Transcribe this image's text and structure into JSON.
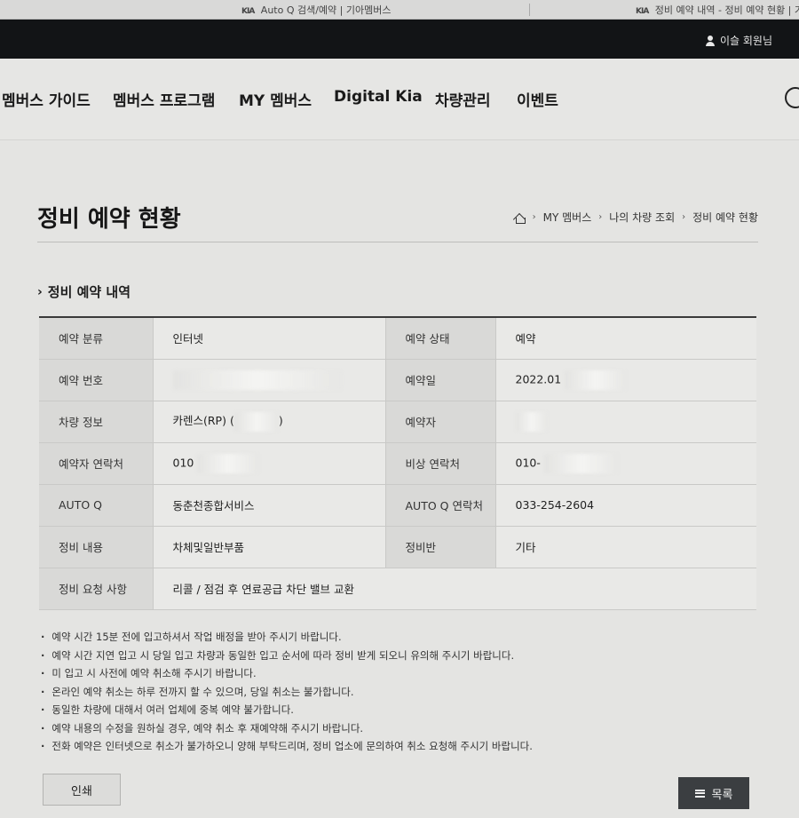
{
  "browser_tabs": [
    {
      "logo": "KIA",
      "title": "Auto Q 검색/예약 | 기아멤버스"
    },
    {
      "logo": "KIA",
      "title": "정비 예약 내역 - 정비 예약 현황 | 기"
    }
  ],
  "topbar": {
    "user_name": "이슬 회원님"
  },
  "nav": [
    {
      "label": "멤버스 가이드"
    },
    {
      "label": "멤버스 프로그램"
    },
    {
      "label": "MY 멤버스"
    },
    {
      "label": "Digital Kia"
    },
    {
      "label": "차량관리"
    },
    {
      "label": "이벤트"
    }
  ],
  "page": {
    "title": "정비 예약 현황"
  },
  "breadcrumb": [
    {
      "label": "MY 멤버스"
    },
    {
      "label": "나의 차량 조회"
    },
    {
      "label": "정비 예약 현황"
    }
  ],
  "section": {
    "title": "정비 예약 내역"
  },
  "details": {
    "type_label": "예약 분류",
    "type_value": "인터넷",
    "status_label": "예약 상태",
    "status_value": "예약",
    "number_label": "예약 번호",
    "number_value": "",
    "date_label": "예약일",
    "date_value": "2022.01",
    "vehicle_label": "차량 정보",
    "vehicle_value_prefix": "카렌스(RP) (",
    "vehicle_value_suffix": ")",
    "booker_label": "예약자",
    "booker_value": "",
    "contact_label": "예약자 연락처",
    "contact_value": "010",
    "emergency_label": "비상 연락처",
    "emergency_value": "010-",
    "autoq_label": "AUTO Q",
    "autoq_value": "동춘천종합서비스",
    "autoq_contact_label": "AUTO Q 연락처",
    "autoq_contact_value": "033-254-2604",
    "content_label": "정비 내용",
    "content_value": "차체및일반부품",
    "team_label": "정비반",
    "team_value": "기타",
    "request_label": "정비 요청 사항",
    "request_value": "리콜 / 점검 후 연료공급 차단 밸브 교환"
  },
  "notes": [
    "예약 시간 15분 전에 입고하셔서 작업 배정을 받아 주시기 바랍니다.",
    "예약 시간 지연 입고 시 당일 입고 차량과 동일한 입고 순서에 따라 정비 받게 되오니 유의해 주시기 바랍니다.",
    "미 입고 시 사전에 예약 취소해 주시기 바랍니다.",
    "온라인 예약 취소는 하루 전까지 할 수 있으며, 당일 취소는 불가합니다.",
    "동일한 차량에 대해서 여러 업체에 중복 예약 불가합니다.",
    "예약 내용의 수정을 원하실 경우, 예약 취소 후 재예약해 주시기 바랍니다.",
    "전화 예약은 인터넷으로 취소가 불가하오니 양해 부탁드리며, 정비 업소에 문의하여 취소 요청해 주시기 바랍니다."
  ],
  "buttons": {
    "print": "인쇄",
    "list": "목록"
  }
}
